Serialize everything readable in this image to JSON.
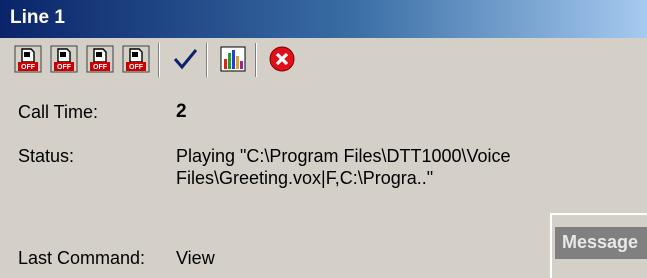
{
  "window": {
    "title": "Line 1"
  },
  "toolbar": {
    "buttons": [
      {
        "icon": "phone-off-icon",
        "badge": "OFF"
      },
      {
        "icon": "phone-off-icon",
        "badge": "OFF"
      },
      {
        "icon": "phone-off-icon",
        "badge": "OFF"
      },
      {
        "icon": "phone-off-icon",
        "badge": "OFF"
      },
      {
        "icon": "checkmark-icon"
      },
      {
        "icon": "bar-chart-icon"
      },
      {
        "icon": "close-circle-icon"
      }
    ],
    "colors": {
      "check": "#0a246a",
      "stop": "#e0101a",
      "badge": "#cc0000"
    }
  },
  "fields": {
    "call_time_label": "Call Time:",
    "call_time_value": "2",
    "status_label": "Status:",
    "status_line1": "Playing \"C:\\Program Files\\DTT1000\\Voice",
    "status_line2": "Files\\Greeting.vox|F,C:\\Progra..\"",
    "last_command_label": "Last Command:",
    "last_command_value": "View"
  },
  "message_panel": {
    "title": "Message"
  }
}
